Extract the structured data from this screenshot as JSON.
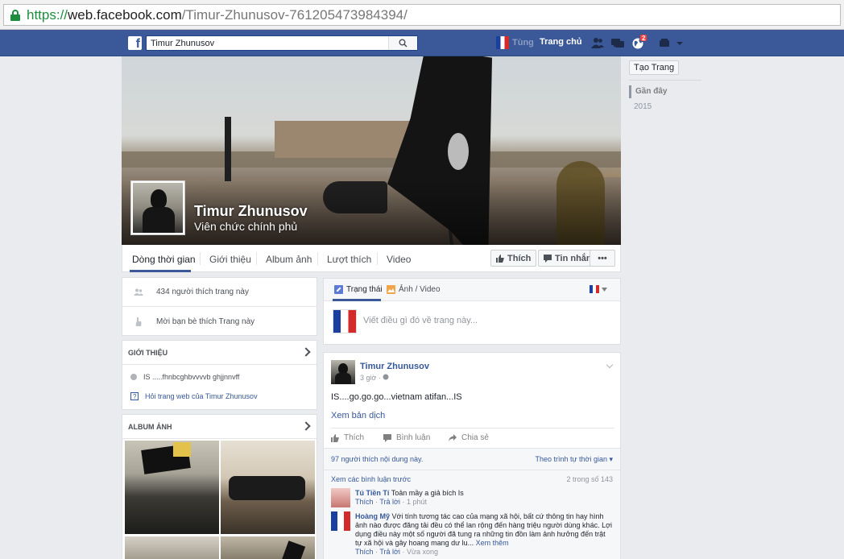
{
  "browser": {
    "url_scheme": "https://",
    "url_host": "web.facebook.com",
    "url_path": "/Timur-Zhunusov-761205473984394/"
  },
  "topbar": {
    "search_value": "Timur Zhunusov",
    "user_name": "Tùng",
    "home_label": "Trang chủ",
    "notification_count": "2",
    "brand_color": "#3b5998"
  },
  "profile": {
    "name": "Timur Zhunusov",
    "category": "Viên chức chính phủ"
  },
  "nav": {
    "tabs": [
      "Dòng thời gian",
      "Giới thiệu",
      "Album ảnh",
      "Lượt thích",
      "Video"
    ],
    "like_button": "Thích",
    "message_button": "Tin nhắn",
    "more_button": "•••"
  },
  "rail": {
    "create_page": "Tạo Trang",
    "years": [
      "Gần đây",
      "2015"
    ]
  },
  "likes": {
    "count_text": "434 người thích trang này",
    "invite_text": "Mời bạn bè thích Trang này"
  },
  "intro": {
    "header": "GIỚI THIỆU",
    "description": "IS .....fhnbcghbvvvvb ghjjnnvff",
    "ask_link": "Hỏi trang web của Timur Zhunusov"
  },
  "album": {
    "header": "ALBUM ẢNH"
  },
  "composer": {
    "status_tab": "Trạng thái",
    "photo_tab": "Ảnh / Video",
    "placeholder": "Viết điều gì đó về trang này..."
  },
  "post": {
    "author": "Timur Zhunusov",
    "time": "3 giờ",
    "text": "IS....go.go.go...vietnam atifan...IS",
    "translate": "Xem bản dịch",
    "actions": [
      "Thích",
      "Bình luận",
      "Chia sẻ"
    ],
    "likes_text": "97 người thích nội dung này.",
    "sort_text": "Theo trình tự thời gian",
    "prev_comments": "Xem các bình luận trước",
    "comment_count": "2 trong số 143",
    "comments": [
      {
        "name": "Tú Tiền Tí",
        "text": "Toản mầy a giả bích Is",
        "like": "Thích",
        "reply": "Trả lời",
        "time": "1 phút"
      },
      {
        "name": "Hoàng Mỹ",
        "text": "Với tính tương tác cao của mạng xã hội, bất cứ thông tin hay hình ảnh nào được đăng tải đều có thể lan rộng đến hàng triệu người dùng khác. Lợi dụng điều này một số người đã tung ra những tin đồn làm ảnh hưởng đến trật tự xã hội và gây hoang mang dư lu...",
        "more": "Xem thêm",
        "like": "Thích",
        "reply": "Trả lời",
        "time": "Vừa xong"
      }
    ]
  }
}
